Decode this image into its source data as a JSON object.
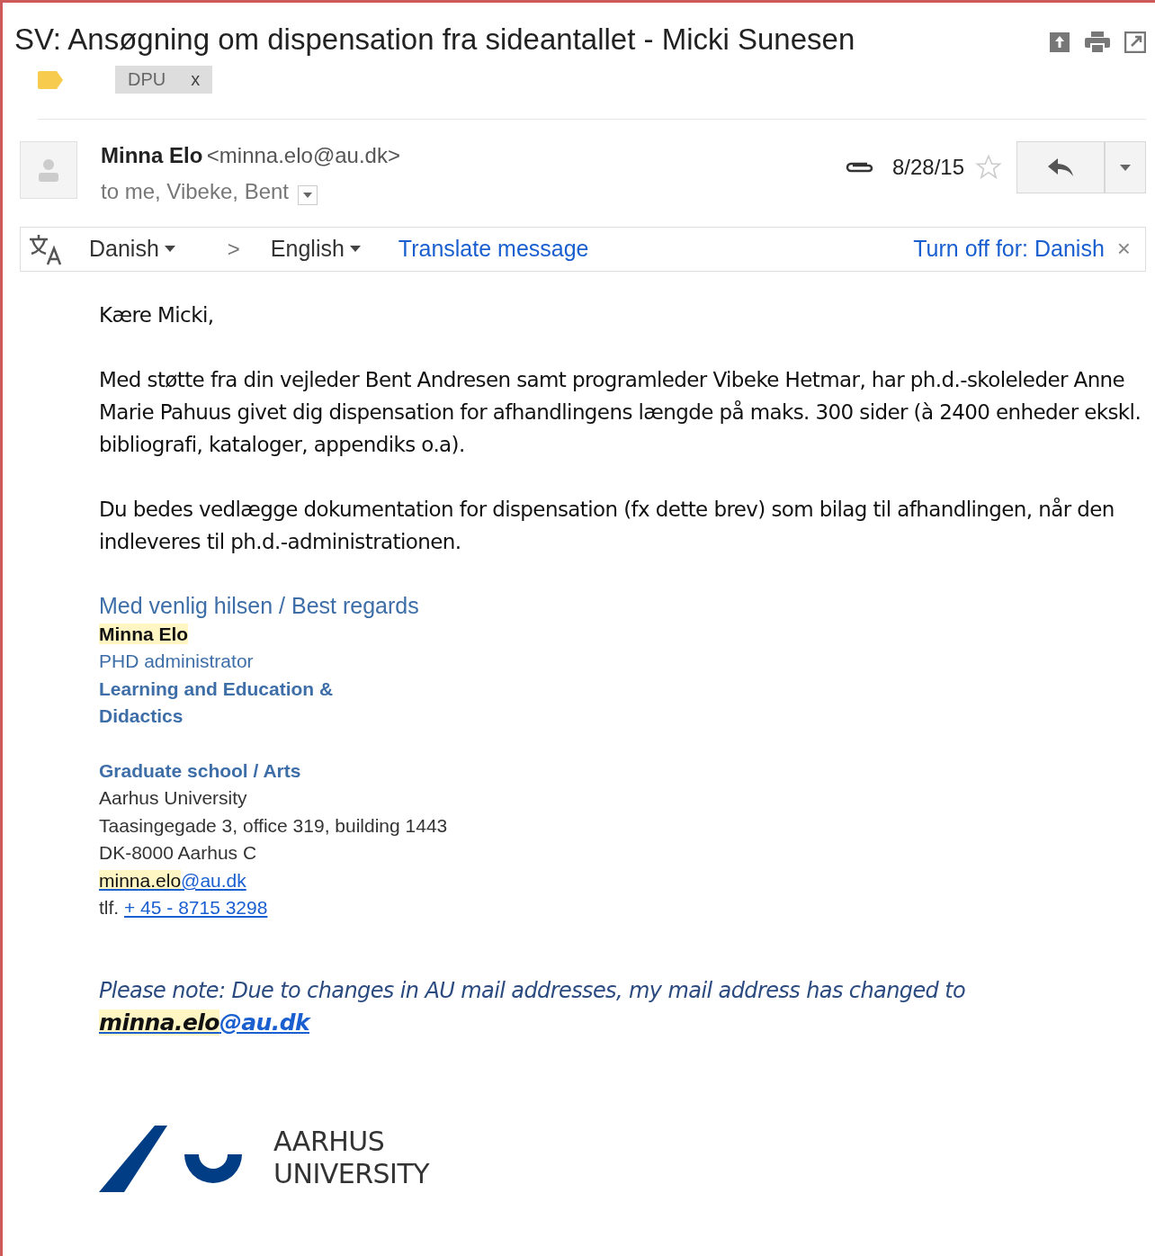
{
  "subject": "SV: Ansøgning om dispensation fra sideantallet - Micki Sunesen",
  "labels": [
    {
      "text": "DPU",
      "remove": "x"
    }
  ],
  "sender": {
    "name": "Minna Elo",
    "email": "<minna.elo@au.dk>",
    "recipients": "to me, Vibeke, Bent",
    "date": "8/28/15",
    "starred": false,
    "has_attachment": true
  },
  "translate_bar": {
    "from": "Danish",
    "separator": ">",
    "to": "English",
    "action": "Translate message",
    "turn_off": "Turn off for: Danish",
    "close": "×"
  },
  "body": {
    "greeting": "Kære Micki,",
    "paragraphs": [
      "Med støtte fra din vejleder Bent Andresen samt programleder Vibeke Hetmar, har ph.d.-skoleleder Anne Marie Pahuus givet dig dispensation for afhandlingens længde på maks. 300 sider (à 2400 enheder ekskl. bibliografi, kataloger, appendiks o.a).",
      "Du bedes vedlægge dokumentation for dispensation (fx dette brev) som bilag til afhandlingen, når den indleveres til ph.d.-administrationen."
    ]
  },
  "signature": {
    "closing": "Med venlig hilsen / Best regards",
    "name": "Minna Elo",
    "title": "PHD administrator",
    "department": [
      "Learning and Education &",
      "Didactics"
    ],
    "school": "Graduate  school / Arts",
    "address": [
      "Aarhus University",
      "Taasingegade 3, office 319, building 1443",
      "DK-8000 Aarhus C"
    ],
    "email_parts": [
      "minna.elo",
      "@au.dk"
    ],
    "phone_label": "tlf.",
    "phone": "+ 45 - 8715 3298"
  },
  "note": {
    "text": "Please note: Due to changes in AU mail addresses, my mail address has changed to",
    "email_parts": [
      "minna.elo",
      "@au.dk"
    ]
  },
  "logo": {
    "lines": [
      "AARHUS",
      "UNIVERSITY"
    ]
  }
}
